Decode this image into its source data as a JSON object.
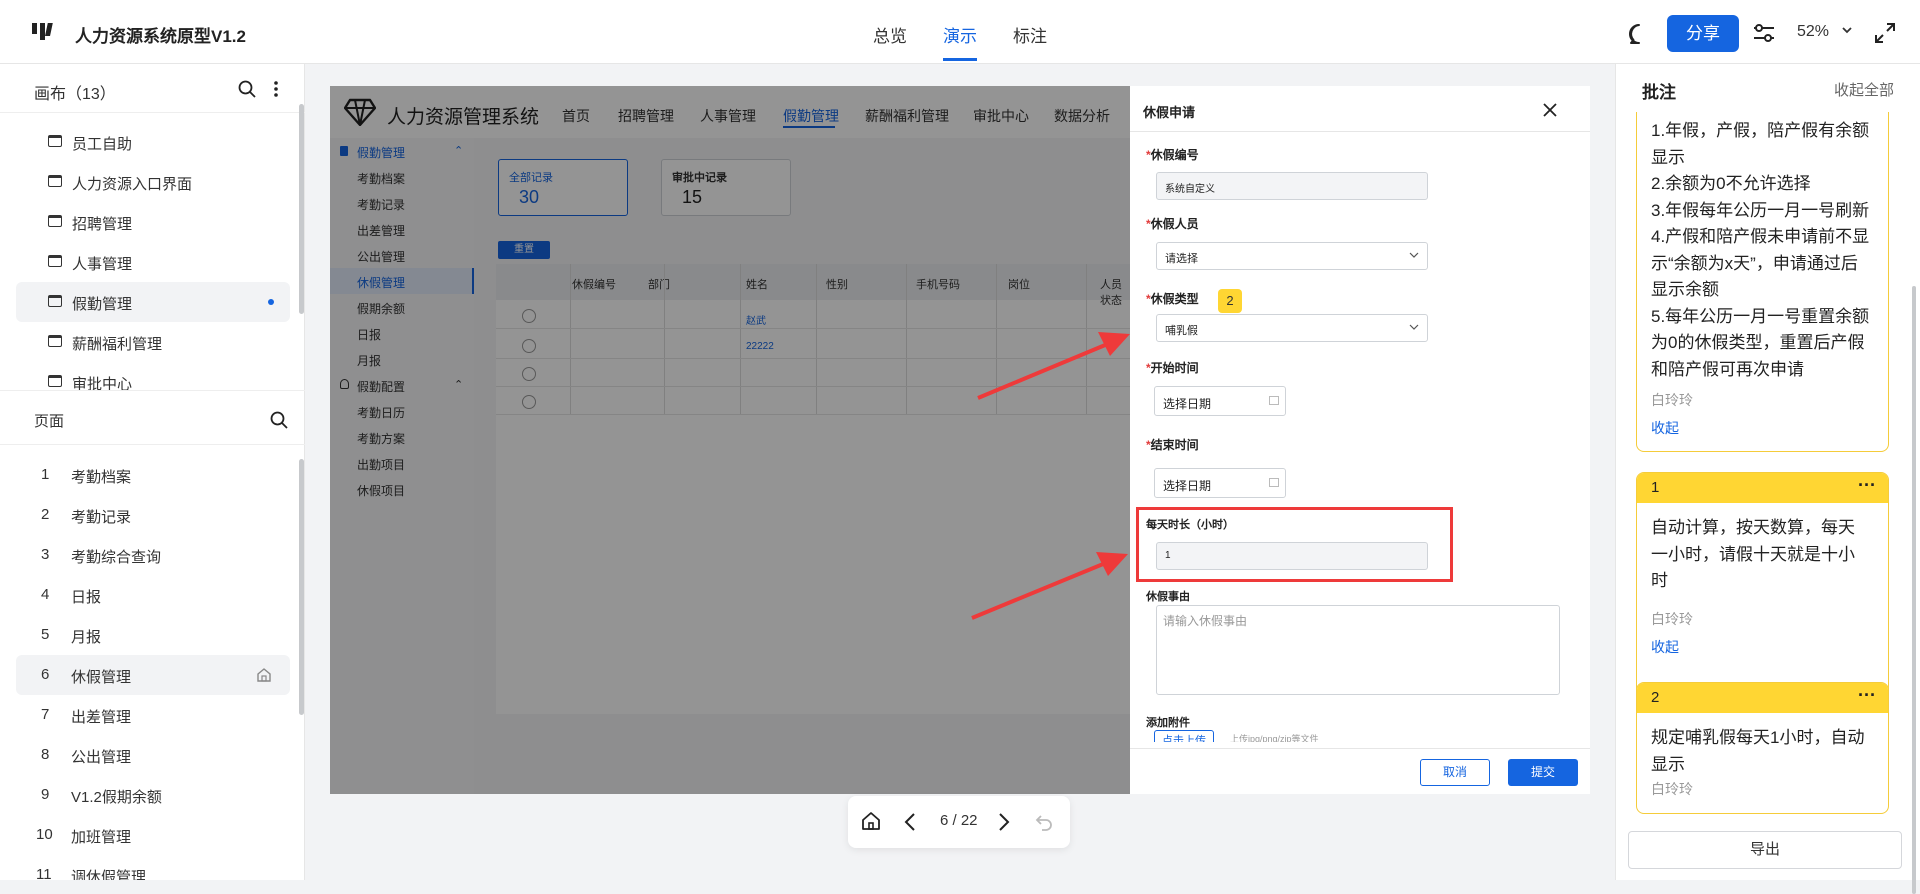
{
  "topbar": {
    "title": "人力资源系统原型V1.2",
    "nav": [
      "总览",
      "演示",
      "标注"
    ],
    "active_nav": "演示",
    "share_label": "分享",
    "zoom": "52%"
  },
  "left_panel": {
    "canvas_header": "画布（13）",
    "canvas_items": [
      "员工自助",
      "人力资源入口界面",
      "招聘管理",
      "人事管理",
      "假勤管理",
      "薪酬福利管理",
      "审批中心"
    ],
    "canvas_selected": "假勤管理",
    "pages_header": "页面",
    "pages": [
      {
        "num": "1",
        "label": "考勤档案"
      },
      {
        "num": "2",
        "label": "考勤记录"
      },
      {
        "num": "3",
        "label": "考勤综合查询"
      },
      {
        "num": "4",
        "label": "日报"
      },
      {
        "num": "5",
        "label": "月报"
      },
      {
        "num": "6",
        "label": "休假管理"
      },
      {
        "num": "7",
        "label": "出差管理"
      },
      {
        "num": "8",
        "label": "公出管理"
      },
      {
        "num": "9",
        "label": "V1.2假期余额"
      },
      {
        "num": "10",
        "label": "加班管理"
      },
      {
        "num": "11",
        "label": "调休假管理"
      }
    ],
    "page_selected": "休假管理"
  },
  "prototype": {
    "system_title": "人力资源管理系统",
    "nav": [
      "首页",
      "招聘管理",
      "人事管理",
      "假勤管理",
      "薪酬福利管理",
      "审批中心",
      "数据分析"
    ],
    "active_nav": "假勤管理",
    "sidebar": {
      "group1": "假勤管理",
      "group1_items": [
        "考勤档案",
        "考勤记录",
        "出差管理",
        "公出管理",
        "休假管理",
        "假期余额",
        "日报",
        "月报"
      ],
      "group1_selected": "休假管理",
      "group2": "假勤配置",
      "group2_items": [
        "考勤日历",
        "考勤方案",
        "出勤项目",
        "休假项目"
      ]
    },
    "stats": [
      {
        "label": "全部记录",
        "value": "30"
      },
      {
        "label": "审批中记录",
        "value": "15"
      }
    ],
    "reset_label": "重置",
    "table_headers": [
      "休假编号",
      "部门",
      "姓名",
      "性别",
      "手机号码",
      "岗位",
      "人员状态"
    ],
    "table_links": [
      "赵武",
      "22222"
    ]
  },
  "drawer": {
    "title": "休假申请",
    "fields": {
      "leave_no_label": "休假编号",
      "leave_no_value": "系统自定义",
      "person_label": "休假人员",
      "person_value": "请选择",
      "type_label": "休假类型",
      "type_value": "哺乳假",
      "start_label": "开始时间",
      "start_value": "选择日期",
      "end_label": "结束时间",
      "end_value": "选择日期",
      "hours_label": "每天时长（小时）",
      "hours_value": "1",
      "reason_label": "休假事由",
      "reason_placeholder": "请输入休假事由",
      "attach_label": "添加附件",
      "upload_label": "点击上传",
      "upload_hint": "上传jpg/png/zip等文件"
    },
    "cancel_label": "取消",
    "submit_label": "提交",
    "marker_badge": "2"
  },
  "pager": {
    "indicator": "6 / 22"
  },
  "right_panel": {
    "title": "批注",
    "collapse_all": "收起全部",
    "cards": [
      {
        "num": "",
        "lines": [
          "1.年假，产假，陪产假有余额",
          "显示",
          "2.余额为0不允许选择",
          "3.年假每年公历一月一号刷新",
          "4.产假和陪产假未申请前不显",
          "示“余额为x天”，申请通过后",
          "显示余额",
          "5.每年公历一月一号重置余额",
          "为0的休假类型，重置后产假",
          "和陪产假可再次申请"
        ],
        "author": "白玲玲",
        "collapse": "收起"
      },
      {
        "num": "1",
        "lines": [
          "自动计算，按天数算，每天",
          "一小时，请假十天就是十小",
          "时"
        ],
        "author": "白玲玲",
        "collapse": "收起"
      },
      {
        "num": "2",
        "lines": [
          "规定哺乳假每天1小时，自动",
          "显示"
        ],
        "author": "白玲玲"
      }
    ],
    "export_label": "导出"
  },
  "colors": {
    "accent": "#1565e0",
    "annotation_yellow": "#ffd633",
    "highlight_red": "#ee3a3a"
  }
}
